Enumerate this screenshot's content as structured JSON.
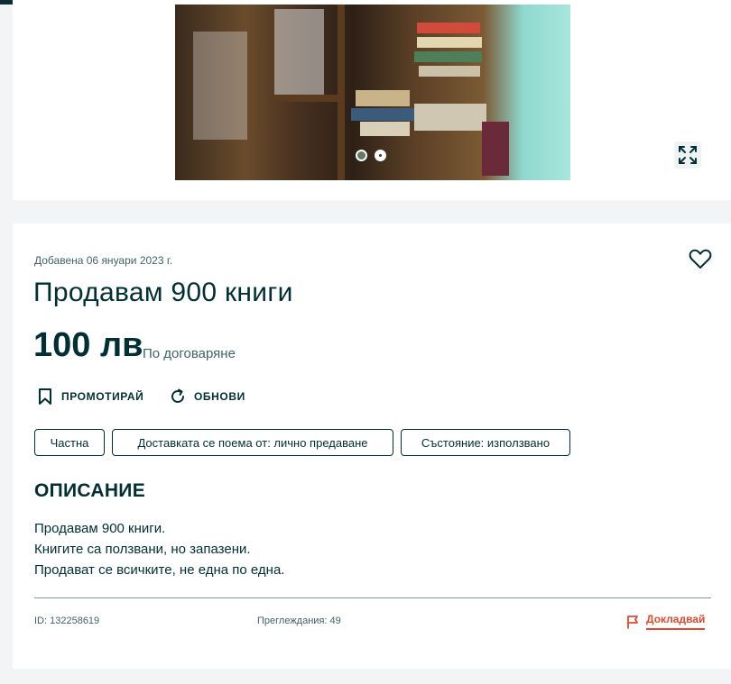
{
  "gallery": {
    "expand_icon": "expand-icon",
    "slide_count": 2,
    "active_slide": 2
  },
  "listing": {
    "added": "Добавена 06 януари 2023 г.",
    "title": "Продавам 900 книги",
    "price": "100 лв",
    "negotiable": "По договаряне",
    "favorite_icon": "heart-icon"
  },
  "actions": {
    "promote": "ПРОМОТИРАЙ",
    "refresh": "ОБНОВИ"
  },
  "tags": [
    "Частна",
    "Доставката се поема от: лично предаване",
    "Състояние: използвано"
  ],
  "description": {
    "heading": "ОПИСАНИЕ",
    "lines": [
      "Продавам 900 книги.",
      "Книгите са ползвани, но запазени.",
      "Продават се всичките, не една по една."
    ]
  },
  "footer": {
    "id": "ID: 132258619",
    "views": "Преглеждания: 49",
    "report": "Докладвай"
  },
  "colors": {
    "text": "#002f34",
    "report": "#e04a2e",
    "background": "#f2f4f5"
  }
}
